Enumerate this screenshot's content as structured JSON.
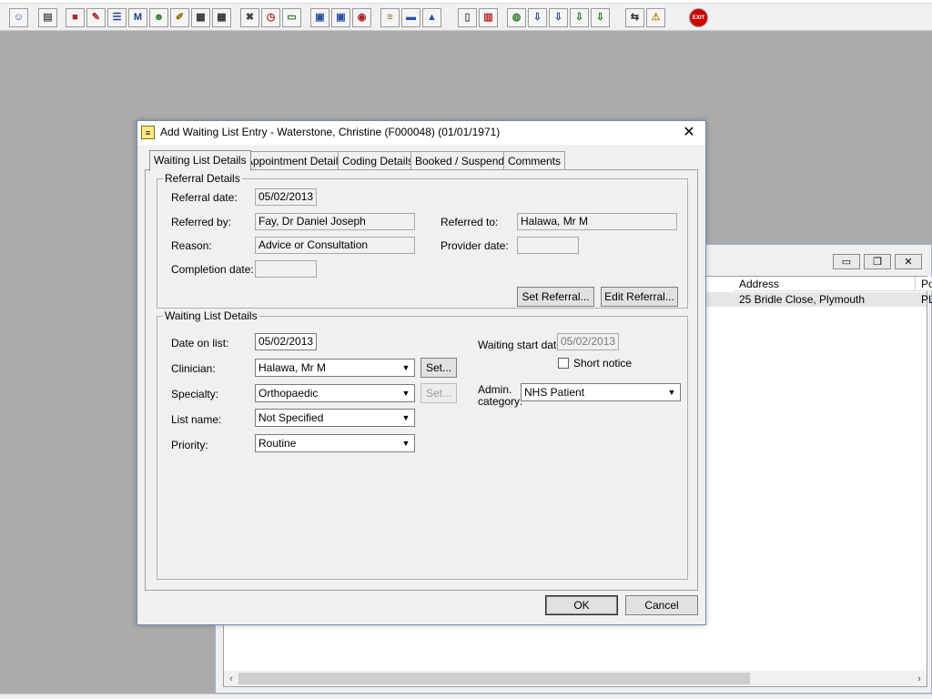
{
  "toolbar": {
    "buttons": [
      {
        "icon": "user-icon",
        "glyph": "☺",
        "color": "#2a4fa8"
      },
      {
        "icon": "printer-icon",
        "glyph": "▤",
        "color": "#555555"
      },
      {
        "icon": "book-red-icon",
        "glyph": "■",
        "color": "#b22222"
      },
      {
        "icon": "document-edit-icon",
        "glyph": "✎",
        "color": "#b22222"
      },
      {
        "icon": "list-icon",
        "glyph": "☰",
        "color": "#1f3f8f"
      },
      {
        "icon": "mail-m-icon",
        "glyph": "M",
        "color": "#1f3f8f"
      },
      {
        "icon": "person-icon",
        "glyph": "☻",
        "color": "#2a7a2a"
      },
      {
        "icon": "notepad-icon",
        "glyph": "✐",
        "color": "#8a6d00"
      },
      {
        "icon": "calendar-icon",
        "glyph": "▦",
        "color": "#333333"
      },
      {
        "icon": "calendar-icon",
        "glyph": "▦",
        "color": "#333333"
      },
      {
        "icon": "cancel-document-icon",
        "glyph": "✖",
        "color": "#444444"
      },
      {
        "icon": "clock-icon",
        "glyph": "◷",
        "color": "#b22222"
      },
      {
        "icon": "monitor-icon",
        "glyph": "▭",
        "color": "#2a7a2a"
      },
      {
        "icon": "screen-icon",
        "glyph": "▣",
        "color": "#2a4fa8"
      },
      {
        "icon": "screen-icon",
        "glyph": "▣",
        "color": "#2a4fa8"
      },
      {
        "icon": "alarm-icon",
        "glyph": "◉",
        "color": "#b22222"
      },
      {
        "icon": "note-icon",
        "glyph": "≡",
        "color": "#8a6d00"
      },
      {
        "icon": "bed-icon",
        "glyph": "▬",
        "color": "#2a4fa8"
      },
      {
        "icon": "ambulance-icon",
        "glyph": "▲",
        "color": "#2a4fa8"
      },
      {
        "icon": "page-icon",
        "glyph": "▯",
        "color": "#555555"
      },
      {
        "icon": "bar-chart-icon",
        "glyph": "▥",
        "color": "#b22222"
      },
      {
        "icon": "globe-icon",
        "glyph": "◍",
        "color": "#2a7a2a"
      },
      {
        "icon": "form-arrow-icon",
        "glyph": "⇩",
        "color": "#2a4fa8"
      },
      {
        "icon": "form-arrow-icon",
        "glyph": "⇩",
        "color": "#2a4fa8"
      },
      {
        "icon": "form-arrow-icon",
        "glyph": "⇩",
        "color": "#2a7a2a"
      },
      {
        "icon": "form-arrow-icon",
        "glyph": "⇩",
        "color": "#2a7a2a"
      },
      {
        "icon": "swap-arrows-icon",
        "glyph": "⇆",
        "color": "#333333"
      },
      {
        "icon": "warning-icon",
        "glyph": "⚠",
        "color": "#b8860b"
      },
      {
        "icon": "exit-icon",
        "glyph": "EXIT",
        "color": "#cc0000"
      }
    ]
  },
  "background_window": {
    "columns": [
      {
        "label": "Address"
      },
      {
        "label": "Po"
      }
    ],
    "row": {
      "address": "25 Bridle Close, Plymouth",
      "po": "PL"
    }
  },
  "dialog": {
    "title": "Add Waiting List Entry - Waterstone, Christine (F000048) (01/01/1971)",
    "tabs": [
      "Waiting List Details",
      "Appointment Details",
      "Coding Details",
      "Booked / Suspend",
      "Comments"
    ],
    "referral": {
      "group_label": "Referral Details",
      "referral_date_label": "Referral date:",
      "referral_date": "05/02/2013",
      "referred_by_label": "Referred by:",
      "referred_by": "Fay, Dr Daniel Joseph",
      "referred_to_label": "Referred to:",
      "referred_to": "Halawa, Mr M",
      "reason_label": "Reason:",
      "reason": "Advice or Consultation",
      "provider_date_label": "Provider date:",
      "provider_date": "",
      "completion_date_label": "Completion date:",
      "completion_date": "",
      "set_referral_label": "Set Referral...",
      "edit_referral_label": "Edit Referral..."
    },
    "waiting": {
      "group_label": "Waiting List Details",
      "date_on_list_label": "Date on list:",
      "date_on_list": "05/02/2013",
      "waiting_start_label": "Waiting start date:",
      "waiting_start": "05/02/2013",
      "short_notice_label": "Short notice",
      "clinician_label": "Clinician:",
      "clinician": "Halawa, Mr M",
      "set_label": "Set...",
      "specialty_label": "Specialty:",
      "specialty": "Orthopaedic",
      "admin_label_1": "Admin.",
      "admin_label_2": "category:",
      "admin_category": "NHS Patient",
      "list_name_label": "List name:",
      "list_name": "Not Specified",
      "priority_label": "Priority:",
      "priority": "Routine"
    },
    "ok_label": "OK",
    "cancel_label": "Cancel"
  }
}
